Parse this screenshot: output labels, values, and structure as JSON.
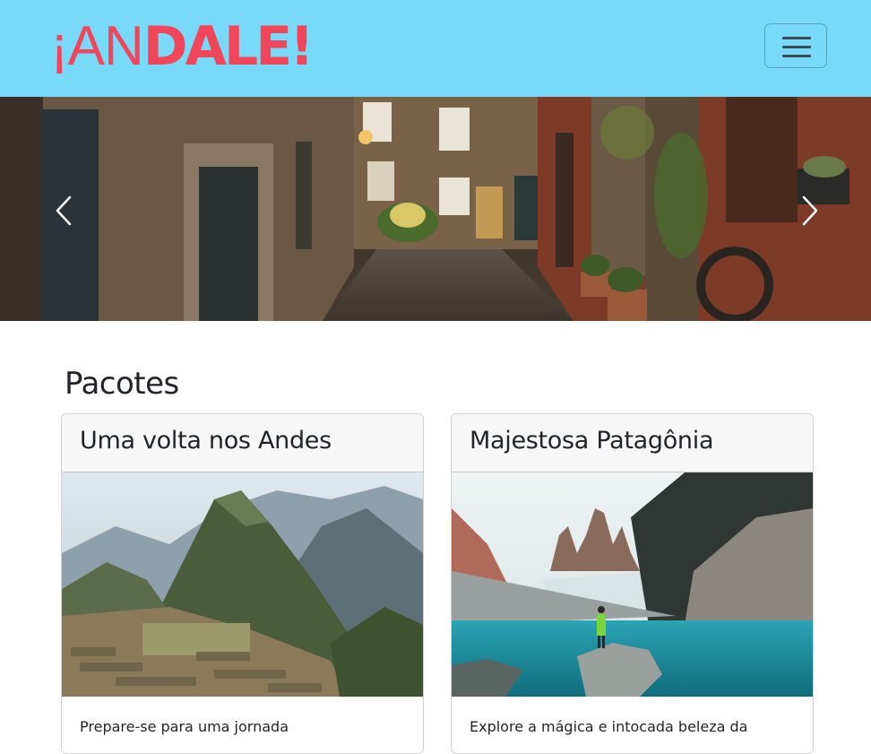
{
  "brand": {
    "part_thin": "¡AN",
    "part_bold": "DALE!"
  },
  "navbar": {
    "toggler_icon": "hamburger-icon",
    "background": "#78d9f8",
    "brand_color": "#f1465a"
  },
  "carousel": {
    "prev_icon": "chevron-left-icon",
    "next_icon": "chevron-right-icon",
    "image_description_icon": "cobblestone-alley-photo"
  },
  "section": {
    "title": "Pacotes"
  },
  "cards": [
    {
      "title": "Uma volta nos Andes",
      "image_icon": "machu-picchu-photo",
      "text": "Prepare-se para uma jornada"
    },
    {
      "title": "Majestosa Patagônia",
      "image_icon": "torres-del-paine-photo",
      "text": "Explore a mágica e intocada beleza da"
    }
  ]
}
